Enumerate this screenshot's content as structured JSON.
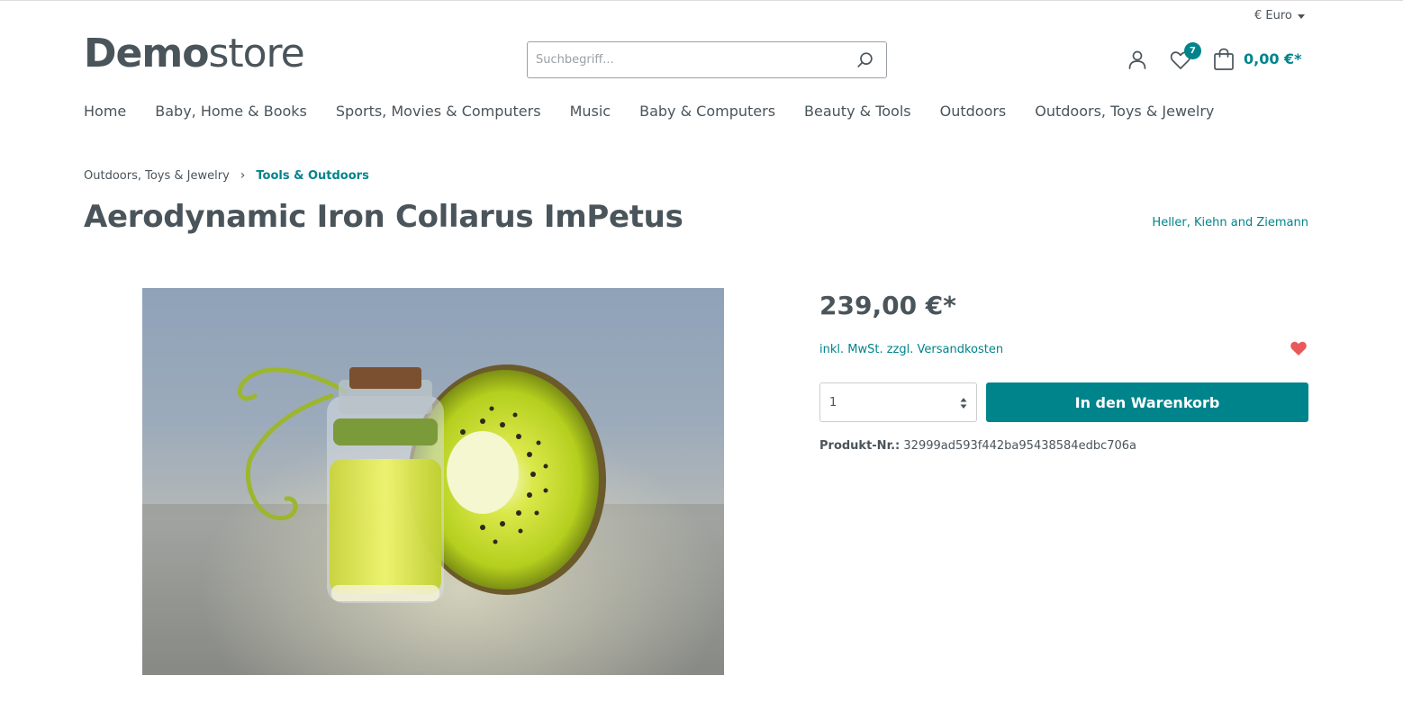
{
  "header": {
    "currency": "€ Euro",
    "logo_bold": "Demo",
    "logo_light": "store",
    "search_placeholder": "Suchbegriff...",
    "wishlist_count": "7",
    "cart_total": "0,00 €*"
  },
  "nav": {
    "items": [
      "Home",
      "Baby, Home & Books",
      "Sports, Movies & Computers",
      "Music",
      "Baby & Computers",
      "Beauty & Tools",
      "Outdoors",
      "Outdoors, Toys & Jewelry"
    ]
  },
  "breadcrumb": {
    "parent": "Outdoors, Toys & Jewelry",
    "current": "Tools & Outdoors"
  },
  "product": {
    "title": "Aerodynamic Iron Collarus ImPetus",
    "manufacturer": "Heller, Kiehn and Ziemann",
    "price": "239,00 €*",
    "tax_note": "inkl. MwSt. zzgl. Versandkosten",
    "quantity": "1",
    "buy_label": "In den Warenkorb",
    "sku_label": "Produkt-Nr.:",
    "sku_value": "32999ad593f442ba95438584edbc706a"
  },
  "colors": {
    "accent": "#00848b",
    "text": "#4a545b",
    "wishlist_heart": "#e85a5a"
  },
  "icons": {
    "search": "search-icon",
    "account": "user-icon",
    "wishlist": "heart-outline-icon",
    "cart": "bag-icon",
    "added_wishlist": "heart-filled-icon"
  }
}
